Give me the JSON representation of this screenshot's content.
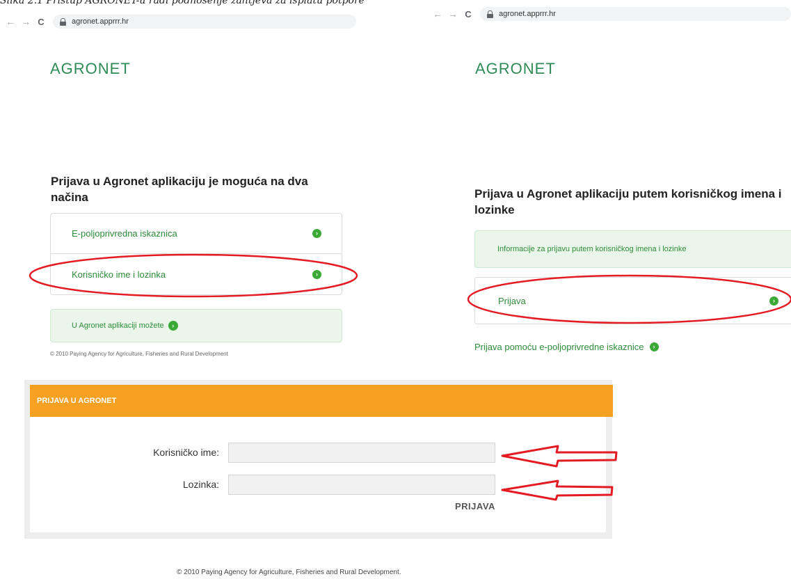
{
  "caption": "Slika 2.1 Pristup AGRONET-u radi podnošenje zahtjeva za isplatu potpore",
  "left_screen": {
    "browser": {
      "back": "←",
      "forward": "→",
      "reload": "C",
      "url": "agronet.apprrr.hr"
    },
    "logo": "AGRONET",
    "heading": "Prijava u Agronet aplikaciju je moguća na dva načina",
    "options": [
      {
        "label": "E-poljoprivredna iskaznica",
        "icon": "arrow-circle-icon"
      },
      {
        "label": "Korisničko ime i lozinka",
        "icon": "arrow-circle-icon"
      }
    ],
    "info_link": "U Agronet aplikaciji možete",
    "footer": "© 2010 Paying Agency for Agriculture, Fisheries and Rural Development"
  },
  "right_screen": {
    "browser": {
      "back": "←",
      "forward": "→",
      "reload": "C",
      "url": "agronet.apprrr.hr"
    },
    "logo": "AGRONET",
    "heading": "Prijava u Agronet aplikaciju putem korisničkog imena i lozinke",
    "info": "Informacije za prijavu putem korisničkog imena i lozinke",
    "login_option": "Prijava",
    "alt_link": "Prijava pomoću e-poljoprivredne iskaznice"
  },
  "login_form": {
    "header": "PRIJAVA U AGRONET",
    "username_label": "Korisničko ime:",
    "username_value": "",
    "password_label": "Lozinka:",
    "password_value": "",
    "submit": "PRIJAVA",
    "footer": "© 2010 Paying Agency for Agriculture, Fisheries and Rural Development."
  },
  "colors": {
    "brand_green": "#2e8b57",
    "link_green": "#2e8b3a",
    "icon_green": "#3aa935",
    "header_orange": "#f7a123",
    "highlight_red": "#e31b23"
  }
}
